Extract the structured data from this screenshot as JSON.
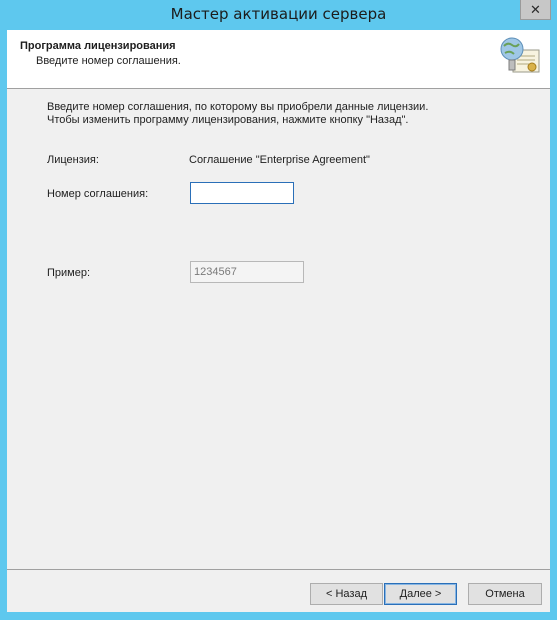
{
  "window": {
    "title": "Мастер активации сервера",
    "close_glyph": "✕"
  },
  "header": {
    "title": "Программа лицензирования",
    "subtitle": "Введите номер соглашения.",
    "icon": "certificate-globe-icon"
  },
  "body": {
    "intro_line1": "Введите номер соглашения, по которому вы приобрели данные лицензии.",
    "intro_line2": "Чтобы изменить программу лицензирования, нажмите кнопку \"Назад\".",
    "license_label": "Лицензия:",
    "license_value": "Соглашение \"Enterprise Agreement\"",
    "agreement_label": "Номер соглашения:",
    "agreement_value": "",
    "example_label": "Пример:",
    "example_value": "1234567"
  },
  "footer": {
    "back_label": "< Назад",
    "next_label": "Далее >",
    "cancel_label": "Отмена"
  },
  "colors": {
    "frame": "#5ec8ee",
    "focus_border": "#2a6fb8"
  }
}
